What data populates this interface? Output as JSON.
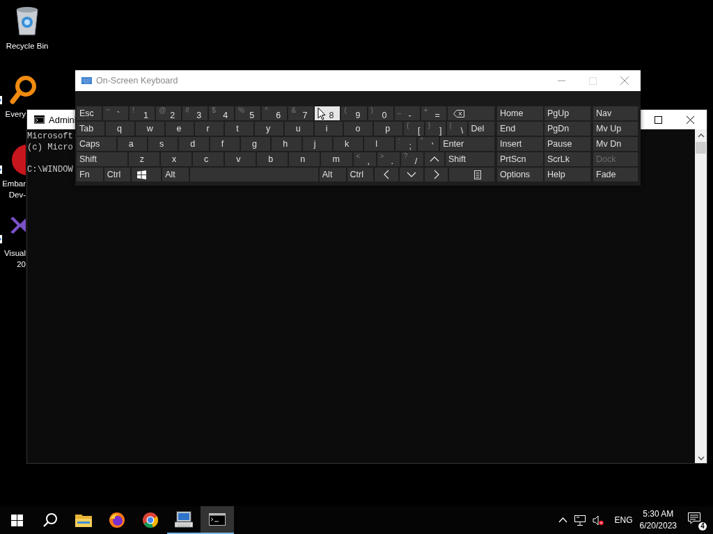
{
  "desktop_icons": [
    {
      "kind": "recycle-bin",
      "shortcut": false,
      "label_lines": [
        "Recycle Bin"
      ]
    },
    {
      "kind": "magnifier",
      "shortcut": true,
      "label_lines": [
        "Every"
      ]
    },
    {
      "kind": "red-logo",
      "shortcut": true,
      "label_lines": [
        "Embar",
        "Dev-"
      ]
    },
    {
      "kind": "ribbon-logo",
      "shortcut": true,
      "label_lines": [
        "Visual",
        "20"
      ]
    }
  ],
  "console_window": {
    "title": "Admini",
    "lines": [
      "Microsoft",
      "(c) Micro",
      "C:\\WINDOW"
    ]
  },
  "keyboard_window": {
    "title": "On-Screen Keyboard",
    "main_rows": [
      [
        {
          "kind": "text",
          "label": "Esc",
          "highlighted": false
        },
        {
          "kind": "dual",
          "secondary": "~",
          "label": "`",
          "highlighted": false
        },
        {
          "kind": "dual",
          "secondary": "!",
          "label": "1",
          "highlighted": false
        },
        {
          "kind": "dual",
          "secondary": "@",
          "label": "2",
          "highlighted": false
        },
        {
          "kind": "dual",
          "secondary": "#",
          "label": "3",
          "highlighted": false
        },
        {
          "kind": "dual",
          "secondary": "$",
          "label": "4",
          "highlighted": false
        },
        {
          "kind": "dual",
          "secondary": "%",
          "label": "5",
          "highlighted": false
        },
        {
          "kind": "dual",
          "secondary": "^",
          "label": "6",
          "highlighted": false
        },
        {
          "kind": "dual",
          "secondary": "&",
          "label": "7",
          "highlighted": false
        },
        {
          "kind": "dual",
          "label": "8",
          "highlighted": true
        },
        {
          "kind": "dual",
          "secondary": "(",
          "label": "9",
          "highlighted": false
        },
        {
          "kind": "dual",
          "secondary": ")",
          "label": "0",
          "highlighted": false
        },
        {
          "kind": "dual",
          "secondary": "_",
          "label": "-",
          "highlighted": false
        },
        {
          "kind": "dual",
          "secondary": "+",
          "label": "=",
          "highlighted": false
        },
        {
          "kind": "backspace",
          "highlighted": false
        }
      ],
      [
        {
          "kind": "text",
          "label": "Tab",
          "highlighted": false
        },
        {
          "kind": "letter",
          "label": "q",
          "highlighted": false
        },
        {
          "kind": "letter",
          "label": "w",
          "highlighted": false
        },
        {
          "kind": "letter",
          "label": "e",
          "highlighted": false
        },
        {
          "kind": "letter",
          "label": "r",
          "highlighted": false
        },
        {
          "kind": "letter",
          "label": "t",
          "highlighted": false
        },
        {
          "kind": "letter",
          "label": "y",
          "highlighted": false
        },
        {
          "kind": "letter",
          "label": "u",
          "highlighted": false
        },
        {
          "kind": "letter",
          "label": "i",
          "highlighted": false
        },
        {
          "kind": "letter",
          "label": "o",
          "highlighted": false
        },
        {
          "kind": "letter",
          "label": "p",
          "highlighted": false
        },
        {
          "kind": "dual",
          "secondary": "{",
          "label": "[",
          "highlighted": false
        },
        {
          "kind": "dual",
          "secondary": "}",
          "label": "]",
          "highlighted": false
        },
        {
          "kind": "dual",
          "secondary": "|",
          "label": "\\",
          "highlighted": false
        },
        {
          "kind": "text",
          "label": "Del",
          "highlighted": false
        }
      ],
      [
        {
          "kind": "text",
          "label": "Caps",
          "highlighted": false
        },
        {
          "kind": "letter",
          "label": "a",
          "highlighted": false
        },
        {
          "kind": "letter",
          "label": "s",
          "highlighted": false
        },
        {
          "kind": "letter",
          "label": "d",
          "highlighted": false
        },
        {
          "kind": "letter",
          "label": "f",
          "highlighted": false
        },
        {
          "kind": "letter",
          "label": "g",
          "highlighted": false
        },
        {
          "kind": "letter",
          "label": "h",
          "highlighted": false
        },
        {
          "kind": "letter",
          "label": "j",
          "highlighted": false
        },
        {
          "kind": "letter",
          "label": "k",
          "highlighted": false
        },
        {
          "kind": "letter",
          "label": "l",
          "highlighted": false
        },
        {
          "kind": "dual",
          "secondary": ":",
          "label": ";",
          "highlighted": false
        },
        {
          "kind": "dual",
          "secondary": "\"",
          "label": "'",
          "highlighted": false
        },
        {
          "kind": "text",
          "label": "Enter",
          "highlighted": false
        }
      ],
      [
        {
          "kind": "text",
          "label": "Shift",
          "highlighted": false
        },
        {
          "kind": "letter",
          "label": "z",
          "highlighted": false
        },
        {
          "kind": "letter",
          "label": "x",
          "highlighted": false
        },
        {
          "kind": "letter",
          "label": "c",
          "highlighted": false
        },
        {
          "kind": "letter",
          "label": "v",
          "highlighted": false
        },
        {
          "kind": "letter",
          "label": "b",
          "highlighted": false
        },
        {
          "kind": "letter",
          "label": "n",
          "highlighted": false
        },
        {
          "kind": "letter",
          "label": "m",
          "highlighted": false
        },
        {
          "kind": "dual",
          "secondary": "<",
          "label": ",",
          "highlighted": false
        },
        {
          "kind": "dual",
          "secondary": ">",
          "label": ".",
          "highlighted": false
        },
        {
          "kind": "dual",
          "secondary": "?",
          "label": "/",
          "highlighted": false
        },
        {
          "kind": "up",
          "highlighted": false
        },
        {
          "kind": "text",
          "label": "Shift",
          "highlighted": false
        }
      ],
      [
        {
          "kind": "text",
          "label": "Fn",
          "highlighted": false
        },
        {
          "kind": "text",
          "label": "Ctrl",
          "highlighted": false
        },
        {
          "kind": "windows",
          "highlighted": false
        },
        {
          "kind": "text",
          "label": "Alt",
          "highlighted": false
        },
        {
          "kind": "space",
          "highlighted": false
        },
        {
          "kind": "text",
          "label": "Alt",
          "highlighted": false
        },
        {
          "kind": "text",
          "label": "Ctrl",
          "highlighted": false
        },
        {
          "kind": "left",
          "highlighted": false
        },
        {
          "kind": "down",
          "highlighted": false
        },
        {
          "kind": "right",
          "highlighted": false
        },
        {
          "kind": "menu",
          "highlighted": false
        }
      ]
    ],
    "nav_rows": [
      [
        {
          "label": "Home",
          "disabled": false
        },
        {
          "label": "PgUp",
          "disabled": false
        },
        {
          "label": "Nav",
          "disabled": false
        }
      ],
      [
        {
          "label": "End",
          "disabled": false
        },
        {
          "label": "PgDn",
          "disabled": false
        },
        {
          "label": "Mv Up",
          "disabled": false
        }
      ],
      [
        {
          "label": "Insert",
          "disabled": false
        },
        {
          "label": "Pause",
          "disabled": false
        },
        {
          "label": "Mv Dn",
          "disabled": false
        }
      ],
      [
        {
          "label": "PrtScn",
          "disabled": false
        },
        {
          "label": "ScrLk",
          "disabled": false
        },
        {
          "label": "Dock",
          "disabled": true
        }
      ],
      [
        {
          "label": "Options",
          "disabled": false
        },
        {
          "label": "Help",
          "disabled": false
        },
        {
          "label": "Fade",
          "disabled": false
        }
      ]
    ]
  },
  "taskbar": {
    "items": [
      {
        "kind": "start",
        "running": false,
        "active": false
      },
      {
        "kind": "search",
        "running": false,
        "active": false
      },
      {
        "kind": "folder",
        "running": false,
        "active": false
      },
      {
        "kind": "fox-browser",
        "running": false,
        "active": false
      },
      {
        "kind": "round-browser",
        "running": false,
        "active": false
      },
      {
        "kind": "monitor",
        "running": true,
        "active": false
      },
      {
        "kind": "terminal",
        "running": true,
        "active": true
      }
    ],
    "language": "ENG",
    "time": "5:30 AM",
    "date": "6/20/2023",
    "notification_count": "4"
  }
}
